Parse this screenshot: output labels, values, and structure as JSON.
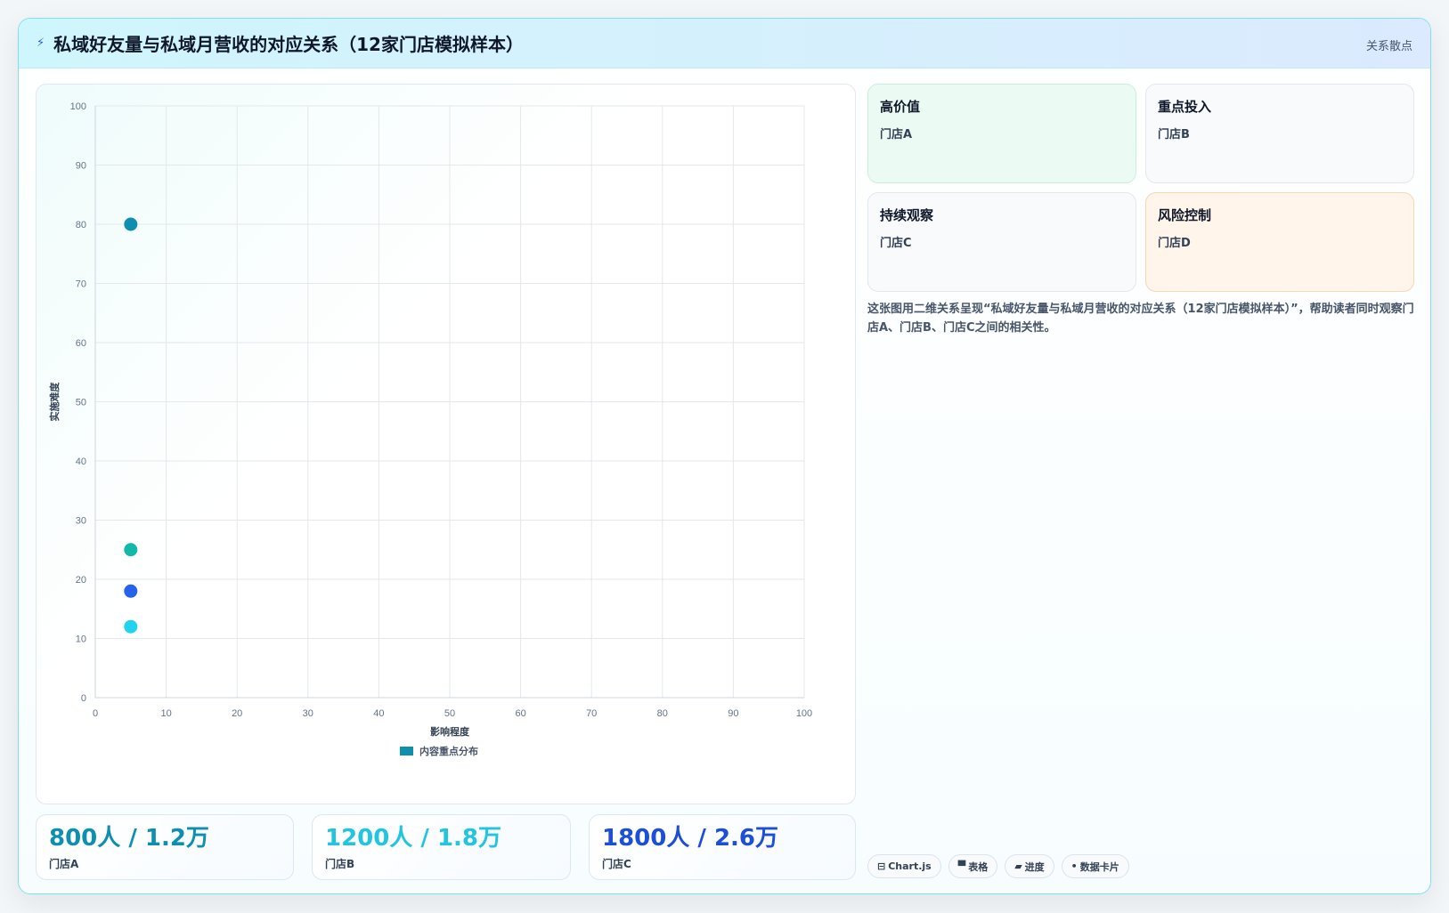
{
  "header": {
    "icon": "lightning-icon",
    "title": "私域好友量与私域月营收的对应关系（12家门店模拟样本）",
    "tag": "关系散点"
  },
  "chart_data": {
    "type": "scatter",
    "xlabel": "影响程度",
    "ylabel": "实施难度",
    "xlim": [
      0,
      100
    ],
    "ylim": [
      0,
      100
    ],
    "xticks": [
      "0",
      "10",
      "20",
      "30",
      "40",
      "50",
      "60",
      "70",
      "80",
      "90",
      "100"
    ],
    "yticks": [
      "0",
      "10",
      "20",
      "30",
      "40",
      "50",
      "60",
      "70",
      "80",
      "90",
      "100"
    ],
    "grid": true,
    "legend_position": "bottom",
    "series": [
      {
        "name": "内容重点分布",
        "color": "#0e8fb0",
        "points": [
          {
            "x": 5,
            "y": 80,
            "color": "#0e8fb0"
          },
          {
            "x": 5,
            "y": 25,
            "color": "#14b8a6"
          },
          {
            "x": 5,
            "y": 18,
            "color": "#2563eb"
          },
          {
            "x": 5,
            "y": 12,
            "color": "#22d3ee"
          }
        ]
      }
    ]
  },
  "stats": [
    {
      "value": "800人 / 1.2万",
      "label": "门店A",
      "color": "#0e8fb0"
    },
    {
      "value": "1200人 / 1.8万",
      "label": "门店B",
      "color": "#22c5e0"
    },
    {
      "value": "1800人 / 2.6万",
      "label": "门店C",
      "color": "#1d4ed8"
    }
  ],
  "quadrants": [
    {
      "name": "高价值",
      "store": "门店A"
    },
    {
      "name": "重点投入",
      "store": "门店B"
    },
    {
      "name": "持续观察",
      "store": "门店C"
    },
    {
      "name": "风险控制",
      "store": "门店D"
    }
  ],
  "description": "这张图用二维关系呈现“私域好友量与私域月营收的对应关系（12家门店模拟样本）”，帮助读者同时观察门店A、门店B、门店C之间的相关性。",
  "chips": [
    {
      "icon": "chart-icon",
      "glyph": "⊟",
      "label": "Chart.js"
    },
    {
      "icon": "table-icon",
      "glyph": "▀",
      "label": "表格"
    },
    {
      "icon": "progress-icon",
      "glyph": "▰",
      "label": "进度"
    },
    {
      "icon": "card-icon",
      "glyph": "•",
      "label": "数据卡片"
    }
  ]
}
